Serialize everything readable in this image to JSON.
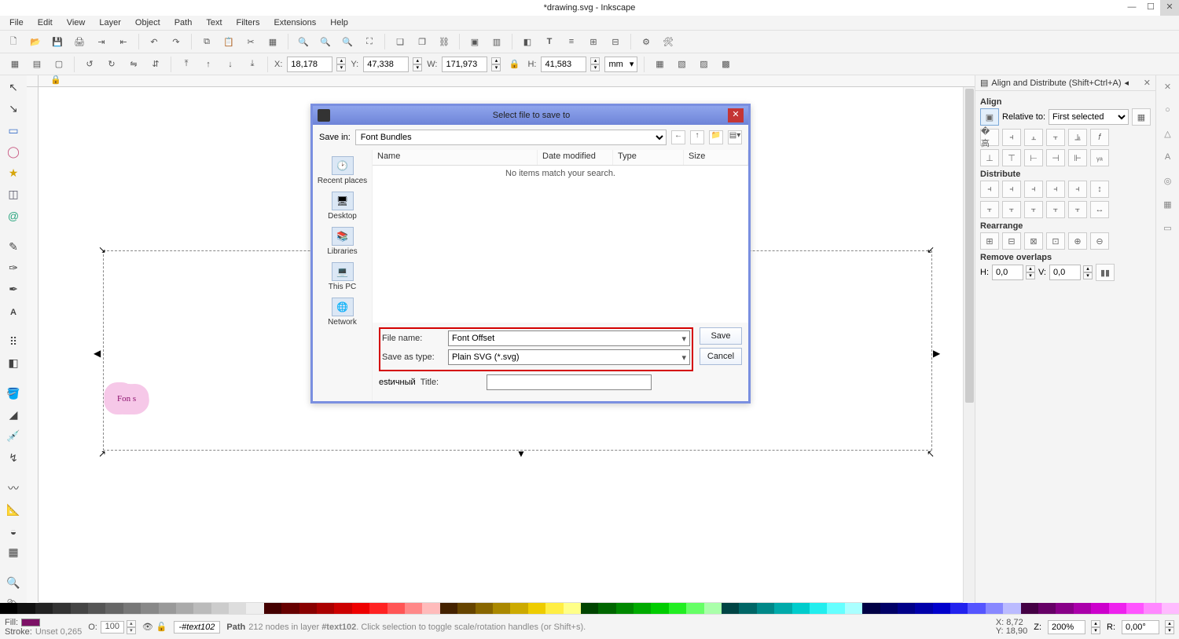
{
  "window": {
    "title": "*drawing.svg - Inkscape"
  },
  "menu": [
    "File",
    "Edit",
    "View",
    "Layer",
    "Object",
    "Path",
    "Text",
    "Filters",
    "Extensions",
    "Help"
  ],
  "coords": {
    "x_label": "X:",
    "x": "18,178",
    "y_label": "Y:",
    "y": "47,338",
    "w_label": "W:",
    "w": "171,973",
    "h_label": "H:",
    "h": "41,583",
    "unit": "mm"
  },
  "panel": {
    "title": "Align and Distribute (Shift+Ctrl+A)",
    "align": "Align",
    "relative": "Relative to:",
    "relative_value": "First selected",
    "distribute": "Distribute",
    "rearrange": "Rearrange",
    "remove": "Remove overlaps",
    "hl": "H:",
    "hv": "0,0",
    "vl": "V:",
    "vv": "0,0"
  },
  "dialog": {
    "title": "Select file to save to",
    "save_in": "Save in:",
    "folder": "Font Bundles",
    "places": [
      "Recent places",
      "Desktop",
      "Libraries",
      "This PC",
      "Network"
    ],
    "cols": {
      "name": "Name",
      "date": "Date modified",
      "type": "Type",
      "size": "Size"
    },
    "empty": "No items match your search.",
    "filename_label": "File name:",
    "filename": "Font Offset",
    "saveas_label": "Save as type:",
    "saveas": "Plain SVG (*.svg)",
    "title_label": "Title:",
    "title_value": "",
    "save": "Save",
    "cancel": "Cancel"
  },
  "canvas_text": "Fon s",
  "status": {
    "fill": "Fill:",
    "stroke": "Stroke:",
    "stroke_val": "Unset",
    "stroke_w": "0,265",
    "op_label": "O:",
    "op": "100",
    "layer": "-#text102",
    "msg_prefix": "Path",
    "msg_nodes": "212 nodes in layer",
    "msg_layer": "#text102",
    "msg_suffix": ". Click selection to toggle scale/rotation handles (or Shift+s).",
    "coord_x": "X:",
    "cx": "8,72",
    "coord_y": "Y:",
    "cy": "18,90",
    "z": "Z:",
    "zoom": "200%",
    "r": "R:",
    "rot": "0,00°"
  }
}
